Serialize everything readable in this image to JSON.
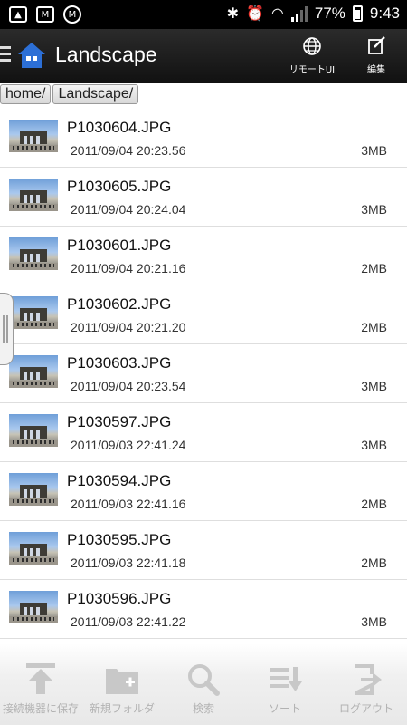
{
  "status_bar": {
    "battery": "77%",
    "time": "9:43"
  },
  "header": {
    "title": "Landscape",
    "remote_label": "リモートUI",
    "edit_label": "編集"
  },
  "breadcrumb": [
    "home/",
    "Landscape/"
  ],
  "files": [
    {
      "name": "P1030604.JPG",
      "date": "2011/09/04 20:23.56",
      "size": "3MB"
    },
    {
      "name": "P1030605.JPG",
      "date": "2011/09/04 20:24.04",
      "size": "3MB"
    },
    {
      "name": "P1030601.JPG",
      "date": "2011/09/04 20:21.16",
      "size": "2MB"
    },
    {
      "name": "P1030602.JPG",
      "date": "2011/09/04 20:21.20",
      "size": "2MB"
    },
    {
      "name": "P1030603.JPG",
      "date": "2011/09/04 20:23.54",
      "size": "3MB"
    },
    {
      "name": "P1030597.JPG",
      "date": "2011/09/03 22:41.24",
      "size": "3MB"
    },
    {
      "name": "P1030594.JPG",
      "date": "2011/09/03 22:41.16",
      "size": "2MB"
    },
    {
      "name": "P1030595.JPG",
      "date": "2011/09/03 22:41.18",
      "size": "2MB"
    },
    {
      "name": "P1030596.JPG",
      "date": "2011/09/03 22:41.22",
      "size": "3MB"
    }
  ],
  "toolbar": {
    "save_label": "接続機器に保存",
    "new_folder_label": "新規フォルダ",
    "search_label": "検索",
    "sort_label": "ソート",
    "logout_label": "ログアウト"
  },
  "colors": {
    "title_bar": "#1a1a1a",
    "home_icon": "#2c6fd6",
    "toolbar_icon": "#c8c8c8"
  }
}
